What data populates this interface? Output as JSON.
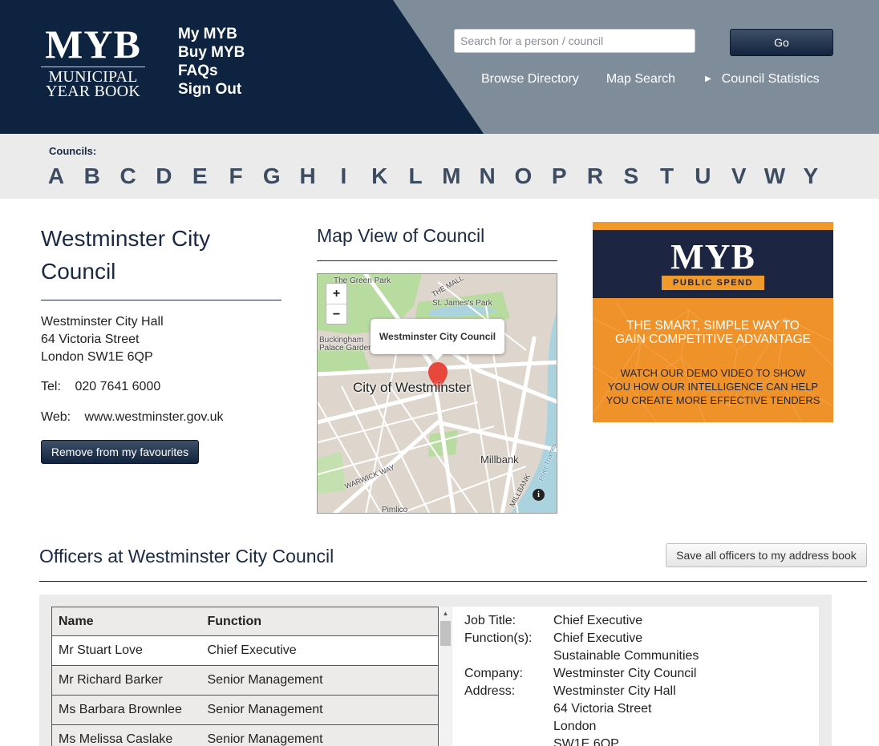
{
  "header": {
    "logo_main": "MYB",
    "logo_line1": "MUNICIPAL",
    "logo_line2": "YEAR BOOK",
    "links": [
      "My MYB",
      "Buy MYB",
      "FAQs",
      "Sign Out"
    ],
    "search_placeholder": "Search for a person / council",
    "go_label": "Go",
    "nav": {
      "browse": "Browse Directory",
      "map": "Map Search",
      "stats": "Council Statistics"
    },
    "colors": {
      "dark": "#0e2340",
      "grey": "#7f8d9b"
    }
  },
  "alphabet": {
    "title": "Councils:",
    "letters": [
      "A",
      "B",
      "C",
      "D",
      "E",
      "F",
      "G",
      "H",
      "I",
      "K",
      "L",
      "M",
      "N",
      "O",
      "P",
      "R",
      "S",
      "T",
      "U",
      "V",
      "W",
      "Y"
    ]
  },
  "council": {
    "name": "Westminster City Council",
    "address": [
      "Westminster City Hall",
      "64 Victoria Street",
      "London SW1E 6QP"
    ],
    "tel_label": "Tel:",
    "tel": "020 7641 6000",
    "web_label": "Web:",
    "web": "www.westminster.gov.uk",
    "favourite_button": "Remove from my favourites"
  },
  "map": {
    "title": "Map View of Council",
    "zoom_in": "+",
    "zoom_out": "−",
    "popup": "Westminster City Council",
    "label_main": "City of Westminster",
    "labels": {
      "green_park": "The Green Park",
      "mall": "THE MALL",
      "st_james": "St. James's Park",
      "buckingham1": "Buckingham",
      "buckingham2": "Palace Garden",
      "millbank": "Millbank",
      "millbank_road": "MILLBANK",
      "warwick": "WARWICK WAY",
      "pimlico": "Pimlico",
      "river": "River Thames"
    },
    "info_icon": "i"
  },
  "ad": {
    "logo": "MYB",
    "badge": "PUBLIC SPEND",
    "tagline": [
      "THE SMART, SIMPLE WAY TO",
      "GAIN COMPETITIVE ADVANTAGE"
    ],
    "body": [
      "WATCH OUR DEMO VIDEO TO SHOW",
      "YOU HOW OUR INTELLIGENCE CAN HELP",
      "YOU CREATE MORE EFFECTIVE TENDERS"
    ]
  },
  "officers": {
    "title": "Officers at Westminster City Council",
    "save_button": "Save all officers to my address book",
    "columns": [
      "Name",
      "Function"
    ],
    "rows": [
      [
        "Mr Stuart Love",
        "Chief Executive"
      ],
      [
        "Mr Richard Barker",
        "Senior Management"
      ],
      [
        "Ms Barbara Brownlee",
        "Senior Management"
      ],
      [
        "Ms Melissa Caslake",
        "Senior Management"
      ]
    ],
    "scroll_up": "▲",
    "detail": {
      "job_title_label": "Job Title:",
      "job_title": "Chief Executive",
      "functions_label": "Function(s):",
      "functions": [
        "Chief Executive",
        "Sustainable Communities"
      ],
      "company_label": "Company:",
      "company": "Westminster City Council",
      "address_label": "Address:",
      "address": [
        "Westminster City Hall",
        "64 Victoria Street",
        "London",
        "SW1E 6QP"
      ]
    }
  }
}
